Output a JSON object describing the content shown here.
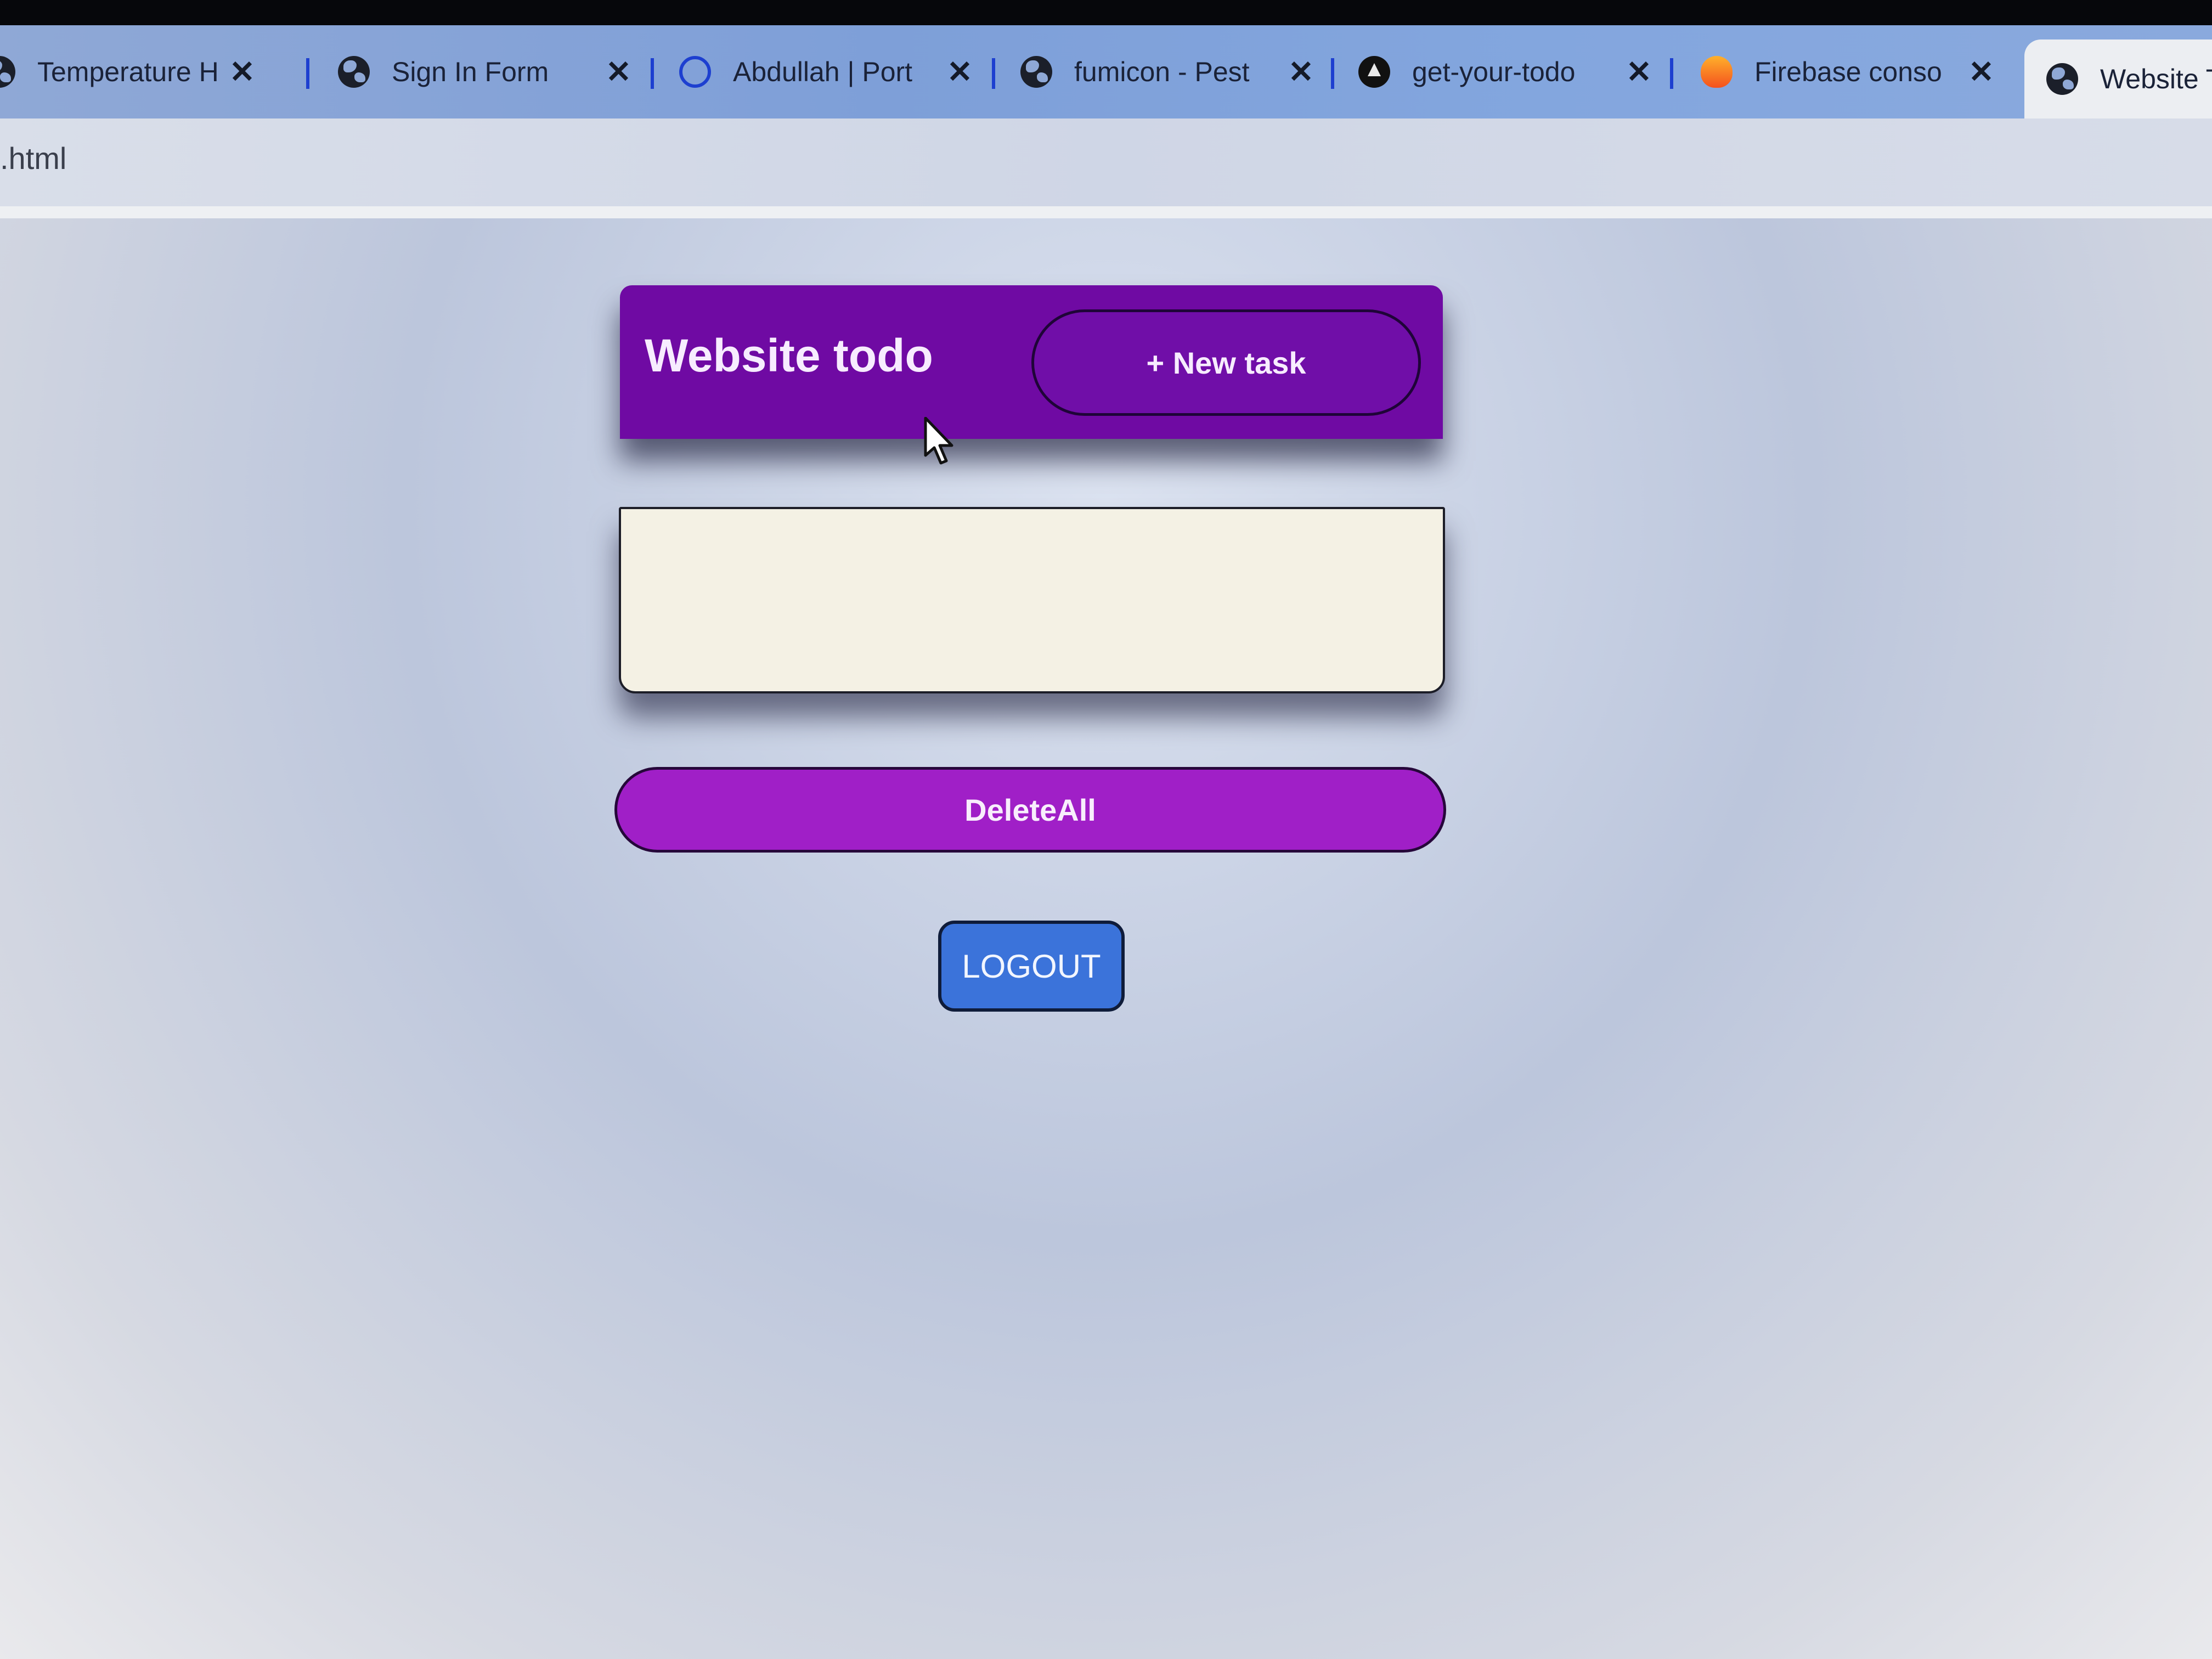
{
  "browser": {
    "tabs": [
      {
        "title": "Temperature H",
        "icon": "globe-icon"
      },
      {
        "title": "Sign In Form",
        "icon": "globe-icon"
      },
      {
        "title": "Abdullah | Port",
        "icon": "portfolio-icon"
      },
      {
        "title": "fumicon - Pest",
        "icon": "globe-icon"
      },
      {
        "title": "get-your-todo",
        "icon": "triangle-logo-icon"
      },
      {
        "title": "Firebase conso",
        "icon": "firebase-flame-icon"
      },
      {
        "title": "Website To",
        "icon": "globe-icon",
        "active": true
      }
    ],
    "close_glyph": "✕",
    "address_text": ".html"
  },
  "todo": {
    "title": "Website todo",
    "new_task_label": "+ New task",
    "tasks": [],
    "delete_all_label": "DeleteAll",
    "logout_label": "LOGOUT"
  },
  "colors": {
    "header": "#6f0aa3",
    "new_task_button": "#700ea8",
    "task_panel": "#f4f1e4",
    "delete_all_button": "#a01fc7",
    "logout_button": "#3b73da"
  }
}
